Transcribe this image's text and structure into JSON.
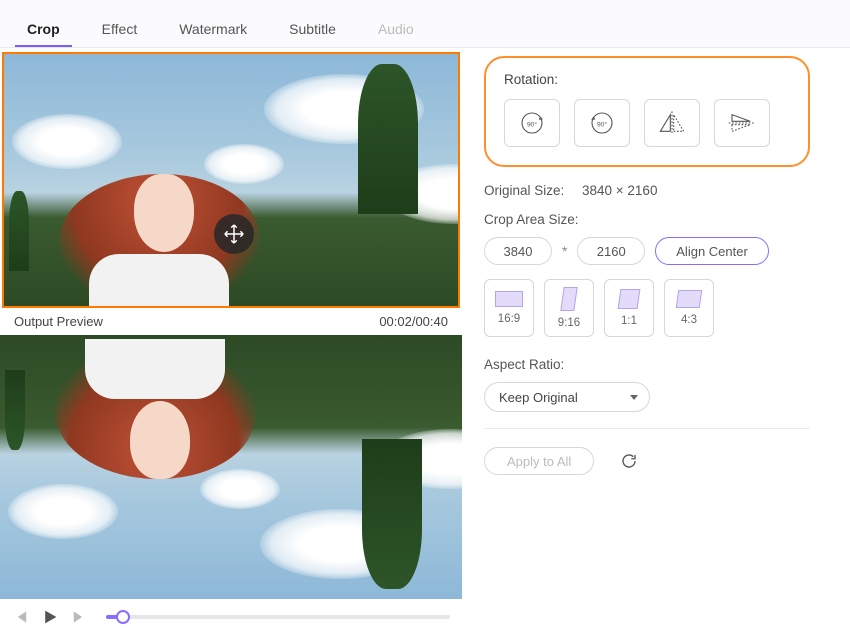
{
  "tabs": {
    "crop": "Crop",
    "effect": "Effect",
    "watermark": "Watermark",
    "subtitle": "Subtitle",
    "audio": "Audio"
  },
  "preview": {
    "label": "Output Preview",
    "time": "00:02/00:40"
  },
  "rotation": {
    "label": "Rotation:"
  },
  "original": {
    "label": "Original Size:",
    "value": "3840 × 2160"
  },
  "cropArea": {
    "label": "Crop Area Size:",
    "w": "3840",
    "h": "2160",
    "mult": "*",
    "align": "Align Center"
  },
  "ratios": {
    "r169": "16:9",
    "r916": "9:16",
    "r11": "1:1",
    "r43": "4:3"
  },
  "aspect": {
    "label": "Aspect Ratio:",
    "value": "Keep Original"
  },
  "actions": {
    "apply": "Apply to All"
  }
}
